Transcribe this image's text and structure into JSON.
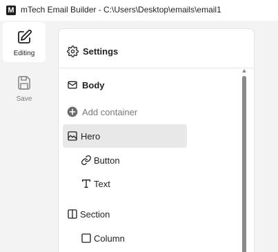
{
  "window": {
    "app_icon_letter": "M",
    "title": "mTech Email Builder - C:\\Users\\Desktop\\emails\\email1"
  },
  "rail": {
    "editing": {
      "label": "Editing",
      "icon": "edit-icon"
    },
    "save": {
      "label": "Save",
      "icon": "save-icon"
    }
  },
  "settings": {
    "title": "Settings",
    "icon": "gear-icon"
  },
  "tree": {
    "body": {
      "label": "Body",
      "icon": "mail-icon"
    },
    "add_container": {
      "label": "Add container",
      "icon": "plus-circle-icon"
    },
    "hero": {
      "label": "Hero",
      "icon": "image-frame-icon",
      "selected": true
    },
    "button": {
      "label": "Button",
      "icon": "link-icon"
    },
    "text": {
      "label": "Text",
      "icon": "text-t-icon"
    },
    "section": {
      "label": "Section",
      "icon": "columns-icon"
    },
    "column": {
      "label": "Column",
      "icon": "square-icon"
    }
  },
  "colors": {
    "selected_row": "#e8e8e8",
    "muted_text": "#7a7a7a",
    "scrollbar": "#8a8a8a"
  }
}
